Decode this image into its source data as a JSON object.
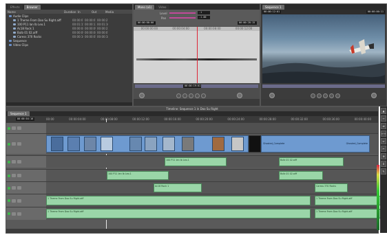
{
  "browser": {
    "tabs": [
      "Effects",
      "Browser"
    ],
    "columns": [
      "Name",
      "Duration",
      "In",
      "Out",
      "Media"
    ],
    "items": [
      {
        "name": "Audio Clips",
        "dur": "",
        "in": "",
        "out": "",
        "kind": "folder"
      },
      {
        "name": "1 Theme From Doo Su Right.aiff",
        "dur": "00:00:07",
        "in": "00:00:01:20",
        "out": "00:00:27:27",
        "kind": "clip"
      },
      {
        "name": "100 P11 Ian Ib Leo.1",
        "dur": "00:01:15",
        "in": "00:00:13:08",
        "out": "00:01:10:00",
        "kind": "clip"
      },
      {
        "name": "Ac18 Rock 1",
        "dur": "00:00:08",
        "in": "00:00:09:03",
        "out": "00:00:23:12",
        "kind": "clip"
      },
      {
        "name": "Bulb 01 02.aiff",
        "dur": "00:00:09",
        "in": "00:00:08:00",
        "out": "00:00:07:20",
        "kind": "clip"
      },
      {
        "name": "Caress 370 Rocks",
        "dur": "00:00:16",
        "in": "00:00:05:09",
        "out": "00:00:18:12",
        "kind": "clip"
      },
      {
        "name": "Sequence",
        "dur": "",
        "in": "",
        "out": "",
        "kind": "folder"
      },
      {
        "name": "Video Clips",
        "dur": "",
        "in": "",
        "out": "",
        "kind": "folder"
      }
    ]
  },
  "viewer": {
    "tabs": [
      "Mono (a1)",
      "Video"
    ],
    "level_label": "Level",
    "pan_label": "Pan",
    "level_value": "-1",
    "pan_value": "-1.00",
    "timecode_left": "00:00:00:00",
    "timecode_right": "00:00:28:15",
    "ruler": [
      "00:00:00:00",
      "00:00:04:00",
      "00:00:08:00",
      "00:00:12:00"
    ],
    "scrub_timecode": "00:00:19:01"
  },
  "canvas": {
    "tabs": [
      "Sequence 1"
    ],
    "timecode_left": "00:00:12:01",
    "timecode_right": "00:00:00:11"
  },
  "timeline": {
    "title": "Timeline: Sequence 1 in Doo Su Right",
    "tab": "Sequence 1",
    "current_timecode": "00:00:04:16",
    "ruler": [
      "00:00",
      "00:00:04:00",
      "00:00:08:00",
      "00:00:12:00",
      "00:00:16:00",
      "00:00:20:00",
      "00:00:24:00",
      "00:00:28:00",
      "00:00:32:00",
      "00:00:36:00",
      "00:00:40:00"
    ],
    "video_labels": [
      "Ghosted_Complete",
      "Ghosted_Complete"
    ],
    "audio_tracks": [
      {
        "track": "A1",
        "clips": [
          "100 P11 Ian Ib Leo.1",
          "Bulb 01 02.aiff"
        ]
      },
      {
        "track": "A2",
        "clips": [
          "100 P11 Ian Ib Leo.1",
          "Bulb 01 02.aiff"
        ]
      },
      {
        "track": "A3",
        "clips": [
          "Ac18 Rock 1",
          "Caress 370 Rocks"
        ]
      },
      {
        "track": "A4",
        "clips": [
          "1 Theme From Doo Su Right.aiff",
          "1 Theme From Doo Su Right.aiff"
        ]
      },
      {
        "track": "A5",
        "clips": [
          "1 Theme From Doo Su Right.aiff",
          "1 Theme From Doo Su Right.aiff"
        ]
      }
    ]
  },
  "colors": {
    "audio_clip": "#9ad6a8",
    "video_clip": "#6e9ad0",
    "panel_bg": "#3c3c3c",
    "timeline_bg": "#565656"
  }
}
